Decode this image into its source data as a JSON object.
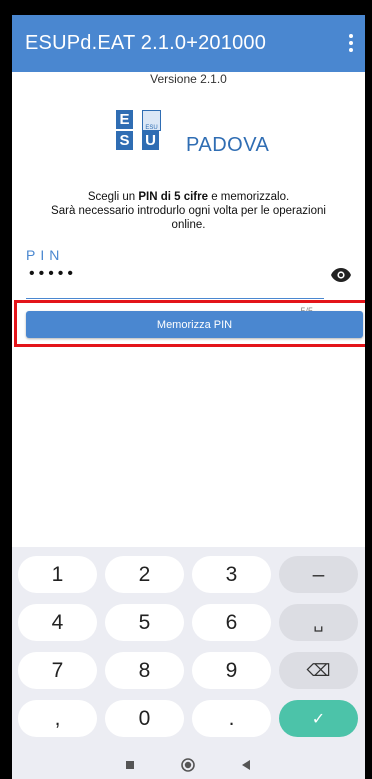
{
  "app": {
    "title": "ESUPd.EAT 2.1.0+201000"
  },
  "header": {
    "version": "Versione 2.1.0"
  },
  "logo": {
    "letters": [
      "E",
      "S",
      "U"
    ],
    "badge": "ESU",
    "name": "PADOVA",
    "color": "#2f6db3"
  },
  "instructions": {
    "line1_pre": "Scegli un ",
    "line1_bold": "PIN di 5 cifre",
    "line1_post": " e memorizzalo.",
    "line2": "Sarà necessario introdurlo ogni volta per le operazioni",
    "line3": "online."
  },
  "pin": {
    "label": "PIN",
    "masked_value": "•••••",
    "counter": "5/5",
    "toggle_icon": "eye-icon"
  },
  "actions": {
    "save_label": "Memorizza PIN"
  },
  "keyboard": {
    "keys": [
      "1",
      "2",
      "3",
      "–",
      "4",
      "5",
      "6",
      "␣",
      "7",
      "8",
      "9",
      "⌫",
      ",",
      "0",
      ".",
      "✓"
    ]
  },
  "navbar": {
    "icons": [
      "recent-apps-icon",
      "home-icon",
      "back-icon"
    ]
  },
  "colors": {
    "appbar": "#4a87d0",
    "accent": "#4a87d0",
    "highlight": "#e3141a",
    "confirm": "#4cc3a9"
  }
}
